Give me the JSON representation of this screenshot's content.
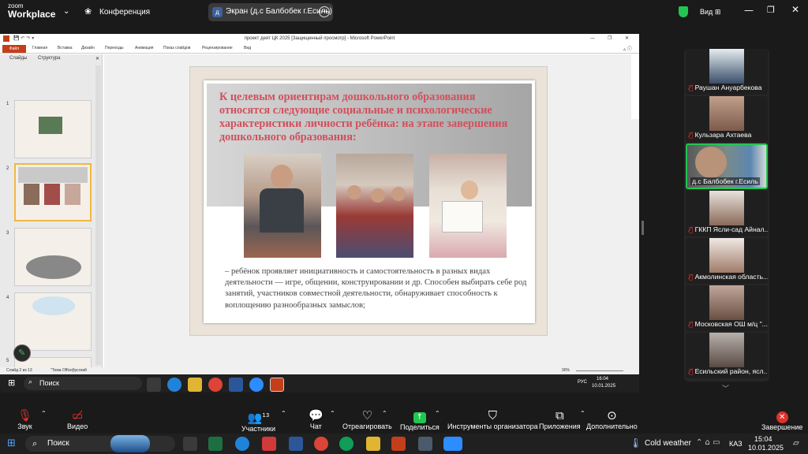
{
  "zoom": {
    "brand_line1": "zoom",
    "brand_line2": "Workplace",
    "meeting_label": "Конференция",
    "sharing_text": "Экран (д.с Балбобек г.Есиль)",
    "sharing_avatar": "д",
    "view_label": "Вид"
  },
  "ppt": {
    "window_title": "проект деят ЦК 2025 [Защищенный просмотр] - Microsoft PowerPoint",
    "file_tab": "Файл",
    "ribbon_tabs": [
      "Главная",
      "Вставка",
      "Дизайн",
      "Переходы",
      "Анимация",
      "Показ слайдов",
      "Рецензирование",
      "Вид"
    ],
    "pane_tabs": [
      "Слайды",
      "Структура"
    ],
    "slide_numbers": [
      "1",
      "2",
      "3",
      "4",
      "5"
    ],
    "status_left": "Слайд 2 из 13",
    "status_theme": "\"Тема Office\"",
    "status_lang": "русский",
    "zoom_pct": "90%",
    "slide_heading": "К целевым ориентирам дошкольного образования относятся следующие социальные и психологические характеристики личности ребёнка: на этапе завершения дошкольного образования:",
    "slide_body": "– ребёнок проявляет инициативность и самостоятельность в разных видах деятельности — игре, общении, конструировании и др. Способен выбирать себе род занятий, участников совместной деятельности, обнаруживает способность к воплощению разнообразных замыслов;"
  },
  "inner_taskbar": {
    "search": "Поиск",
    "lang": "РУС",
    "time": "16:04",
    "date": "10.01.2025"
  },
  "participants": [
    {
      "name": "Раушан Ануарбекова"
    },
    {
      "name": "Кульзара Ахтаева"
    },
    {
      "name": "д.с Балбобек г.Есиль"
    },
    {
      "name": "ГККП Ясли-сад Айнал..."
    },
    {
      "name": "Акмолинская область..."
    },
    {
      "name": "Московская ОШ м/ц \"..."
    },
    {
      "name": "Есильский район, ясл..."
    }
  ],
  "toolbar": {
    "audio": "Звук",
    "video": "Видео",
    "participants": "Участники",
    "participants_count": "13",
    "chat": "Чат",
    "react": "Отреагировать",
    "share": "Поделиться",
    "host_tools": "Инструменты организатора",
    "apps": "Приложения",
    "more": "Дополнительно",
    "end": "Завершение"
  },
  "windows_taskbar": {
    "search": "Поиск",
    "weather": "Cold weather",
    "lang": "КАЗ",
    "time": "15:04",
    "date": "10.01.2025"
  },
  "colors": {
    "accent_green": "#23c552",
    "end_red": "#e0312a",
    "slide_heading": "#d1505d"
  }
}
